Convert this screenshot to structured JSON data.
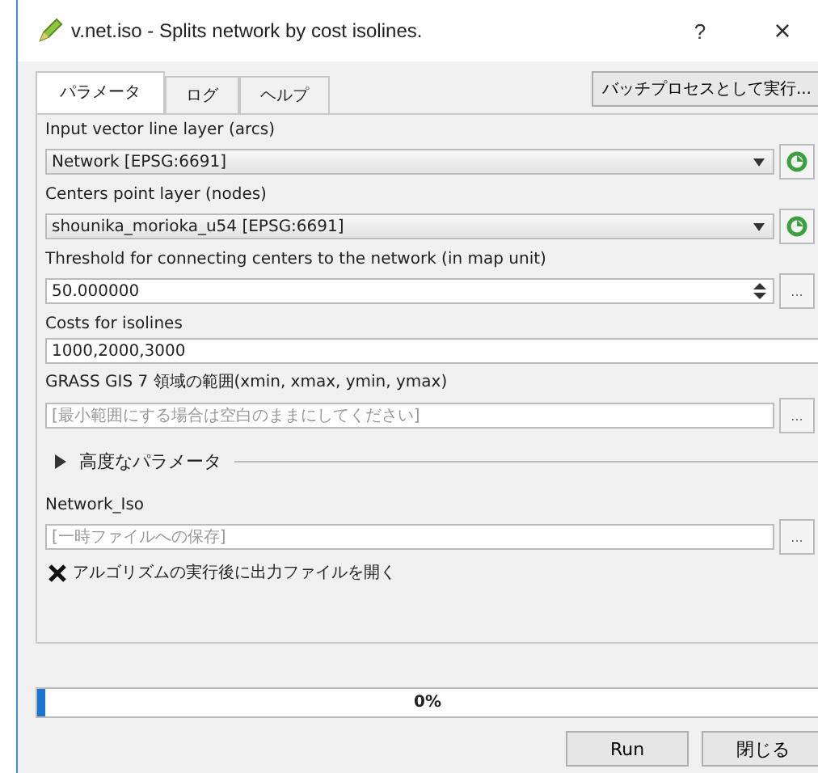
{
  "window": {
    "title": "v.net.iso - Splits network by cost isolines.",
    "help": "?",
    "close": "×"
  },
  "tabs": [
    {
      "label": "パラメータ",
      "selected": true
    },
    {
      "label": "ログ",
      "selected": false
    },
    {
      "label": "ヘルプ",
      "selected": false
    }
  ],
  "batch_button": "バッチプロセスとして実行...",
  "rows": [
    {
      "kind": "combo",
      "label": "Input vector line layer (arcs)",
      "value": "Network [EPSG:6691]"
    },
    {
      "kind": "combo",
      "label": "Centers point layer (nodes)",
      "value": "shounika_morioka_u54 [EPSG:6691]"
    },
    {
      "kind": "spin",
      "label": "Threshold for connecting centers to the network (in map unit)",
      "value": "50.000000",
      "button": "..."
    },
    {
      "kind": "text",
      "label": "Costs for isolines",
      "value": "1000,2000,3000"
    },
    {
      "kind": "file",
      "label": "GRASS GIS 7 領域の範囲(xmin, xmax, ymin, ymax)",
      "placeholder": "[最小範囲にする場合は空白のままにしてください]",
      "button": "..."
    },
    {
      "kind": "section",
      "label": "高度なパラメータ",
      "expanded": false
    },
    {
      "kind": "file",
      "label": "Network_Iso",
      "placeholder": "[一時ファイルへの保存]",
      "button": "..."
    },
    {
      "kind": "check",
      "label": "アルゴリズムの実行後に出力ファイルを開く",
      "checked": true
    }
  ],
  "progress": {
    "level": 0.01,
    "text": "0%"
  },
  "buttons": [
    "Run",
    "閉じる"
  ]
}
